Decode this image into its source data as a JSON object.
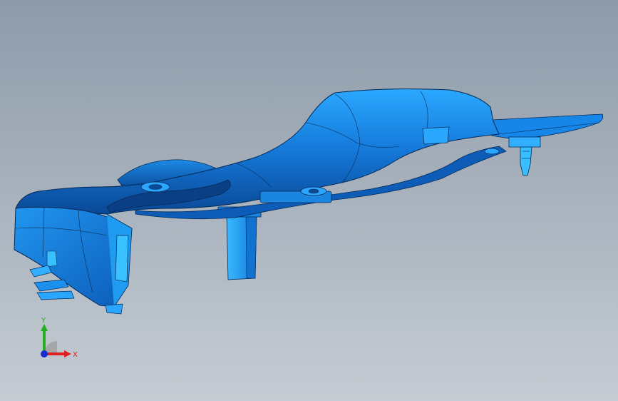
{
  "viewport": {
    "background_top": "#8e9baa",
    "background_bottom": "#c5ccd3"
  },
  "model": {
    "color_main": "#1a86e0",
    "color_dark": "#0a4a96",
    "color_light": "#30b8ff",
    "edge_color": "#062a55"
  },
  "triad": {
    "x_label": "X",
    "y_label": "Y",
    "x_color": "#e02020",
    "y_color": "#22b022",
    "z_color": "#1a2ad8"
  }
}
